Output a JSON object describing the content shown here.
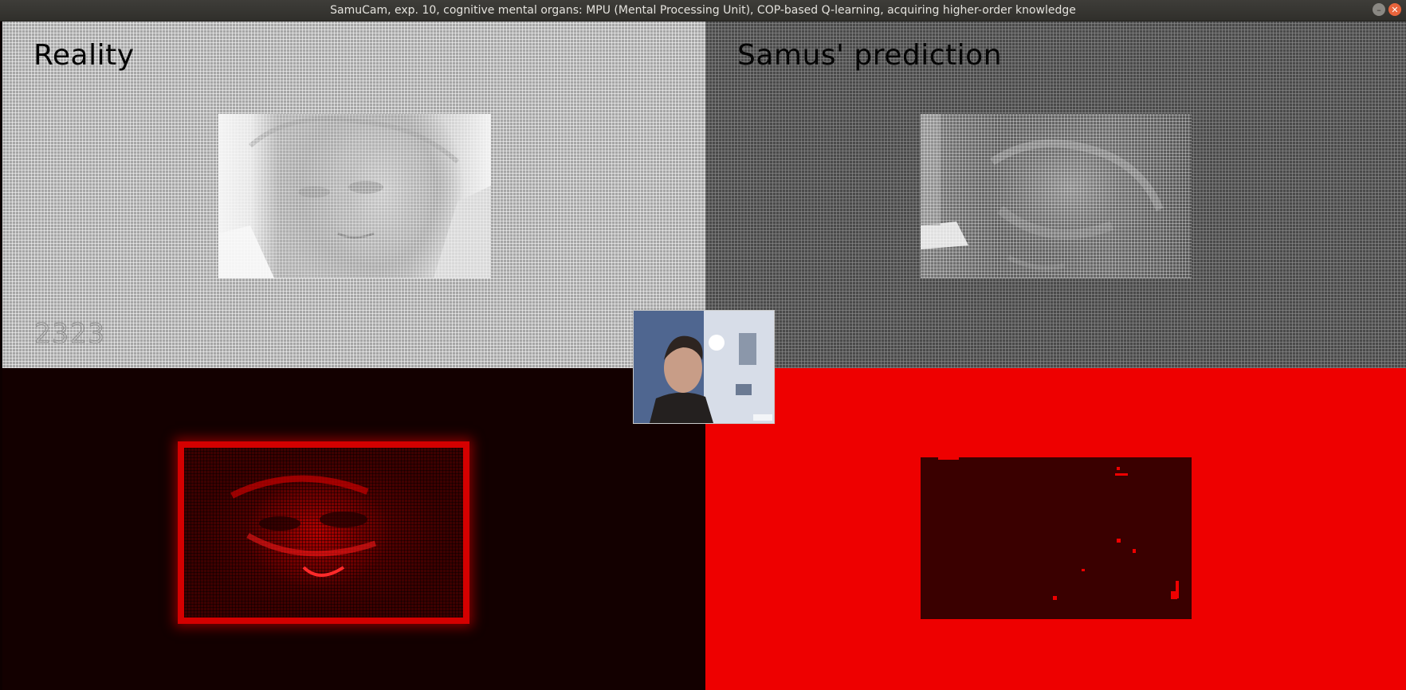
{
  "window": {
    "title": "SamuCam, exp. 10, cognitive mental organs: MPU (Mental Processing Unit), COP-based Q-learning, acquiring higher-order knowledge",
    "minimize_icon": "minimize-icon",
    "close_icon": "close-icon"
  },
  "panels": {
    "reality": {
      "label": "Reality",
      "counter": "2323"
    },
    "prediction": {
      "label": "Samus' prediction"
    }
  },
  "colors": {
    "reality_bg": "#a6a6a6",
    "prediction_bg": "#4a4a4a",
    "error_left_bg": "#130000",
    "error_right_bg": "#ee0000",
    "error_box": "#3a0000"
  }
}
